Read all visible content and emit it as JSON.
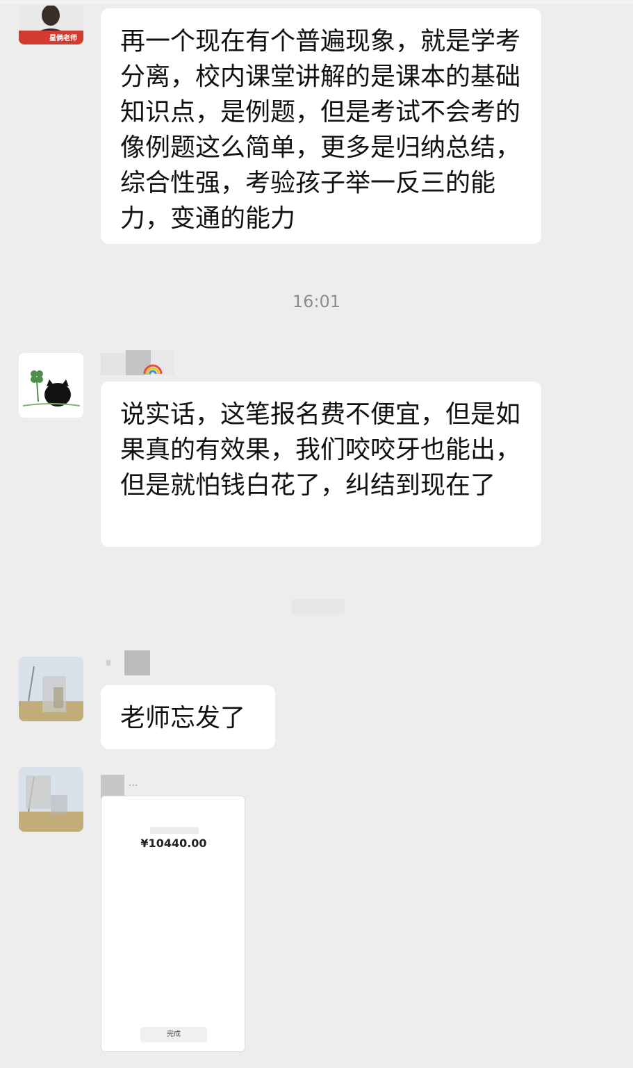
{
  "messages": [
    {
      "avatar_caption": "星俩老师",
      "text": "再一个现在有个普遍现象，就是学考分离，校内课堂讲解的是课本的基础知识点，是例题，但是考试不会考的像例题这么简单，更多是归纳总结，综合性强，考验孩子举一反三的能力，变通的能力"
    },
    {
      "text": "说实话，这笔报名费不便宜，但是如果真的有效果，我们咬咬牙也能出，但是就怕钱白花了，纠结到现在了"
    },
    {
      "text": "老师忘发了"
    },
    {
      "sender_suffix": "...",
      "card": {
        "amount": "¥10440.00",
        "button_label": "完成"
      }
    }
  ],
  "timestamp": "16:01",
  "colors": {
    "background": "#ededed",
    "bubble": "#ffffff",
    "text": "#111111",
    "timestamp": "#8c8c8c"
  }
}
